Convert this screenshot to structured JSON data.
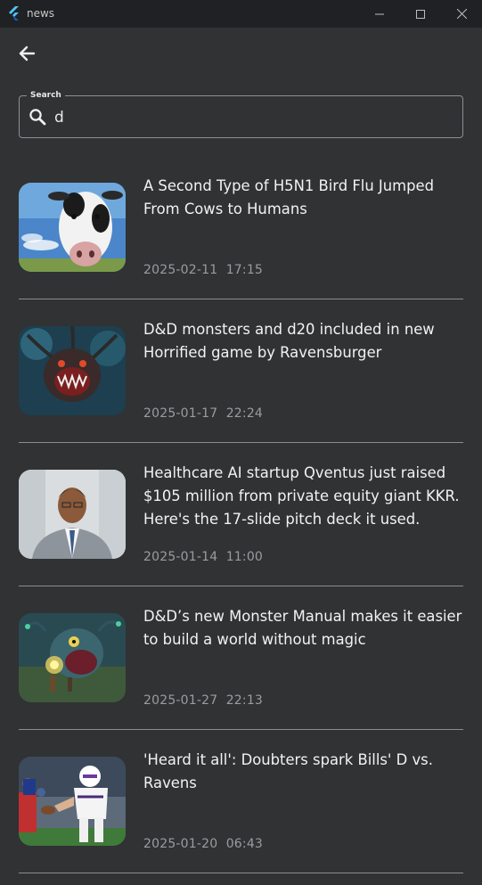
{
  "window": {
    "title": "news",
    "controls": {
      "minimize_icon": "minimize-icon",
      "maximize_icon": "maximize-icon",
      "close_icon": "close-icon"
    }
  },
  "nav": {
    "back_icon": "arrow-left-icon"
  },
  "search": {
    "label": "Search",
    "value": "d",
    "icon": "search-icon"
  },
  "articles": [
    {
      "title": "A Second Type of H5N1 Bird Flu Jumped From Cows to Humans",
      "date": "2025-02-11",
      "time": "17:15",
      "thumb": "cow-photo"
    },
    {
      "title": "D&D monsters and d20 included in new Horrified game by Ravensburger",
      "date": "2025-01-17",
      "time": "22:24",
      "thumb": "monster-photo"
    },
    {
      "title": "Healthcare AI startup Qventus just raised $105 million from private equity giant KKR. Here's the 17-slide pitch deck it used.",
      "date": "2025-01-14",
      "time": "11:00",
      "thumb": "person-photo"
    },
    {
      "title": "D&D’s new Monster Manual makes it easier to build a world without magic",
      "date": "2025-01-27",
      "time": "22:13",
      "thumb": "beholder-art"
    },
    {
      "title": "'Heard it all': Doubters spark Bills' D vs. Ravens",
      "date": "2025-01-20",
      "time": "06:43",
      "thumb": "football-photo"
    }
  ],
  "colors": {
    "background": "#303234",
    "titlebar": "#202124",
    "divider": "#8a8c8f",
    "date_text": "#9a9c9f"
  }
}
